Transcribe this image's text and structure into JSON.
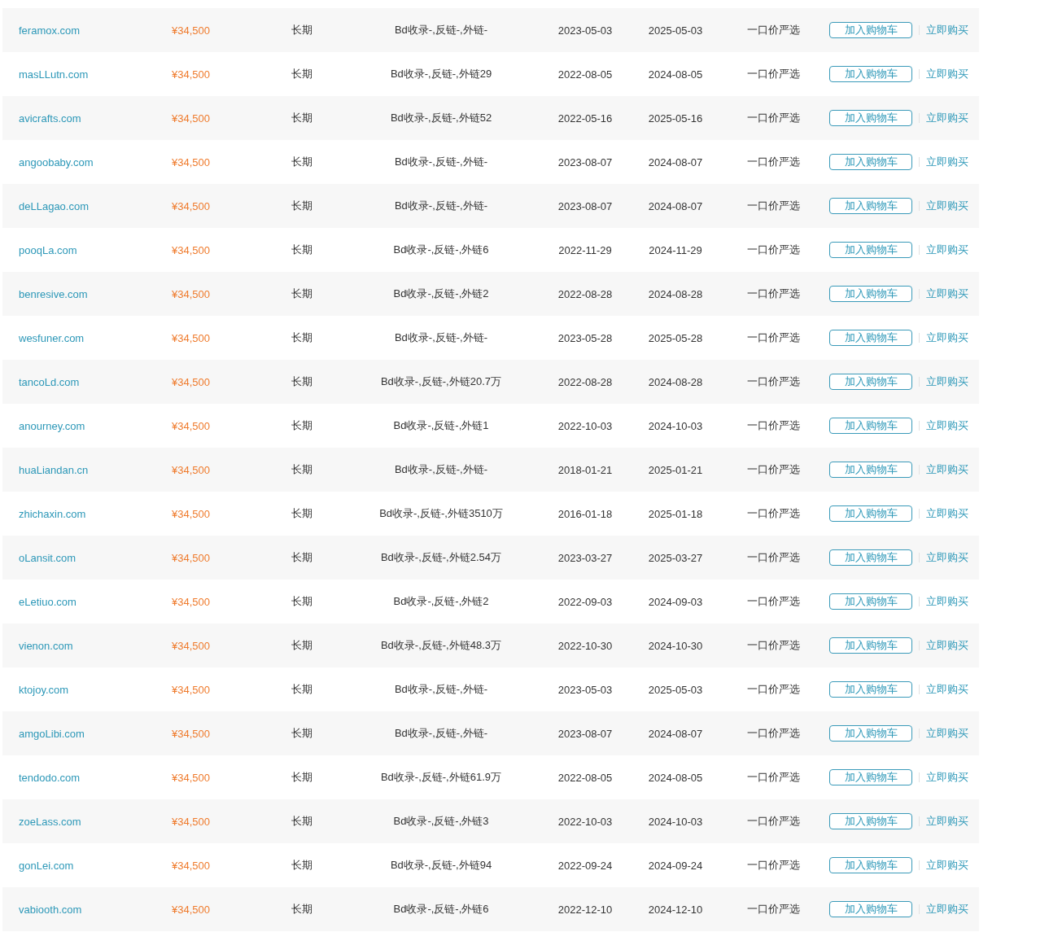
{
  "rows": [
    {
      "domain": "feramox.com",
      "price": "¥34,500",
      "term": "长期",
      "seo": "Bd收录-,反链-,外链-",
      "registered": "2023-05-03",
      "expires": "2025-05-03",
      "sale_type": "一口价严选",
      "cart_button": "加入购物车",
      "buy_link": "立即购买"
    },
    {
      "domain": "masLLutn.com",
      "price": "¥34,500",
      "term": "长期",
      "seo": "Bd收录-,反链-,外链29",
      "registered": "2022-08-05",
      "expires": "2024-08-05",
      "sale_type": "一口价严选",
      "cart_button": "加入购物车",
      "buy_link": "立即购买"
    },
    {
      "domain": "avicrafts.com",
      "price": "¥34,500",
      "term": "长期",
      "seo": "Bd收录-,反链-,外链52",
      "registered": "2022-05-16",
      "expires": "2025-05-16",
      "sale_type": "一口价严选",
      "cart_button": "加入购物车",
      "buy_link": "立即购买"
    },
    {
      "domain": "angoobaby.com",
      "price": "¥34,500",
      "term": "长期",
      "seo": "Bd收录-,反链-,外链-",
      "registered": "2023-08-07",
      "expires": "2024-08-07",
      "sale_type": "一口价严选",
      "cart_button": "加入购物车",
      "buy_link": "立即购买"
    },
    {
      "domain": "deLLagao.com",
      "price": "¥34,500",
      "term": "长期",
      "seo": "Bd收录-,反链-,外链-",
      "registered": "2023-08-07",
      "expires": "2024-08-07",
      "sale_type": "一口价严选",
      "cart_button": "加入购物车",
      "buy_link": "立即购买"
    },
    {
      "domain": "pooqLa.com",
      "price": "¥34,500",
      "term": "长期",
      "seo": "Bd收录-,反链-,外链6",
      "registered": "2022-11-29",
      "expires": "2024-11-29",
      "sale_type": "一口价严选",
      "cart_button": "加入购物车",
      "buy_link": "立即购买"
    },
    {
      "domain": "benresive.com",
      "price": "¥34,500",
      "term": "长期",
      "seo": "Bd收录-,反链-,外链2",
      "registered": "2022-08-28",
      "expires": "2024-08-28",
      "sale_type": "一口价严选",
      "cart_button": "加入购物车",
      "buy_link": "立即购买"
    },
    {
      "domain": "wesfuner.com",
      "price": "¥34,500",
      "term": "长期",
      "seo": "Bd收录-,反链-,外链-",
      "registered": "2023-05-28",
      "expires": "2025-05-28",
      "sale_type": "一口价严选",
      "cart_button": "加入购物车",
      "buy_link": "立即购买"
    },
    {
      "domain": "tancoLd.com",
      "price": "¥34,500",
      "term": "长期",
      "seo": "Bd收录-,反链-,外链20.7万",
      "registered": "2022-08-28",
      "expires": "2024-08-28",
      "sale_type": "一口价严选",
      "cart_button": "加入购物车",
      "buy_link": "立即购买"
    },
    {
      "domain": "anourney.com",
      "price": "¥34,500",
      "term": "长期",
      "seo": "Bd收录-,反链-,外链1",
      "registered": "2022-10-03",
      "expires": "2024-10-03",
      "sale_type": "一口价严选",
      "cart_button": "加入购物车",
      "buy_link": "立即购买"
    },
    {
      "domain": "huaLiandan.cn",
      "price": "¥34,500",
      "term": "长期",
      "seo": "Bd收录-,反链-,外链-",
      "registered": "2018-01-21",
      "expires": "2025-01-21",
      "sale_type": "一口价严选",
      "cart_button": "加入购物车",
      "buy_link": "立即购买"
    },
    {
      "domain": "zhichaxin.com",
      "price": "¥34,500",
      "term": "长期",
      "seo": "Bd收录-,反链-,外链3510万",
      "registered": "2016-01-18",
      "expires": "2025-01-18",
      "sale_type": "一口价严选",
      "cart_button": "加入购物车",
      "buy_link": "立即购买"
    },
    {
      "domain": "oLansit.com",
      "price": "¥34,500",
      "term": "长期",
      "seo": "Bd收录-,反链-,外链2.54万",
      "registered": "2023-03-27",
      "expires": "2025-03-27",
      "sale_type": "一口价严选",
      "cart_button": "加入购物车",
      "buy_link": "立即购买"
    },
    {
      "domain": "eLetiuo.com",
      "price": "¥34,500",
      "term": "长期",
      "seo": "Bd收录-,反链-,外链2",
      "registered": "2022-09-03",
      "expires": "2024-09-03",
      "sale_type": "一口价严选",
      "cart_button": "加入购物车",
      "buy_link": "立即购买"
    },
    {
      "domain": "vienon.com",
      "price": "¥34,500",
      "term": "长期",
      "seo": "Bd收录-,反链-,外链48.3万",
      "registered": "2022-10-30",
      "expires": "2024-10-30",
      "sale_type": "一口价严选",
      "cart_button": "加入购物车",
      "buy_link": "立即购买"
    },
    {
      "domain": "ktojoy.com",
      "price": "¥34,500",
      "term": "长期",
      "seo": "Bd收录-,反链-,外链-",
      "registered": "2023-05-03",
      "expires": "2025-05-03",
      "sale_type": "一口价严选",
      "cart_button": "加入购物车",
      "buy_link": "立即购买"
    },
    {
      "domain": "amgoLibi.com",
      "price": "¥34,500",
      "term": "长期",
      "seo": "Bd收录-,反链-,外链-",
      "registered": "2023-08-07",
      "expires": "2024-08-07",
      "sale_type": "一口价严选",
      "cart_button": "加入购物车",
      "buy_link": "立即购买"
    },
    {
      "domain": "tendodo.com",
      "price": "¥34,500",
      "term": "长期",
      "seo": "Bd收录-,反链-,外链61.9万",
      "registered": "2022-08-05",
      "expires": "2024-08-05",
      "sale_type": "一口价严选",
      "cart_button": "加入购物车",
      "buy_link": "立即购买"
    },
    {
      "domain": "zoeLass.com",
      "price": "¥34,500",
      "term": "长期",
      "seo": "Bd收录-,反链-,外链3",
      "registered": "2022-10-03",
      "expires": "2024-10-03",
      "sale_type": "一口价严选",
      "cart_button": "加入购物车",
      "buy_link": "立即购买"
    },
    {
      "domain": "gonLei.com",
      "price": "¥34,500",
      "term": "长期",
      "seo": "Bd收录-,反链-,外链94",
      "registered": "2022-09-24",
      "expires": "2024-09-24",
      "sale_type": "一口价严选",
      "cart_button": "加入购物车",
      "buy_link": "立即购买"
    },
    {
      "domain": "vabiooth.com",
      "price": "¥34,500",
      "term": "长期",
      "seo": "Bd收录-,反链-,外链6",
      "registered": "2022-12-10",
      "expires": "2024-12-10",
      "sale_type": "一口价严选",
      "cart_button": "加入购物车",
      "buy_link": "立即购买"
    }
  ]
}
